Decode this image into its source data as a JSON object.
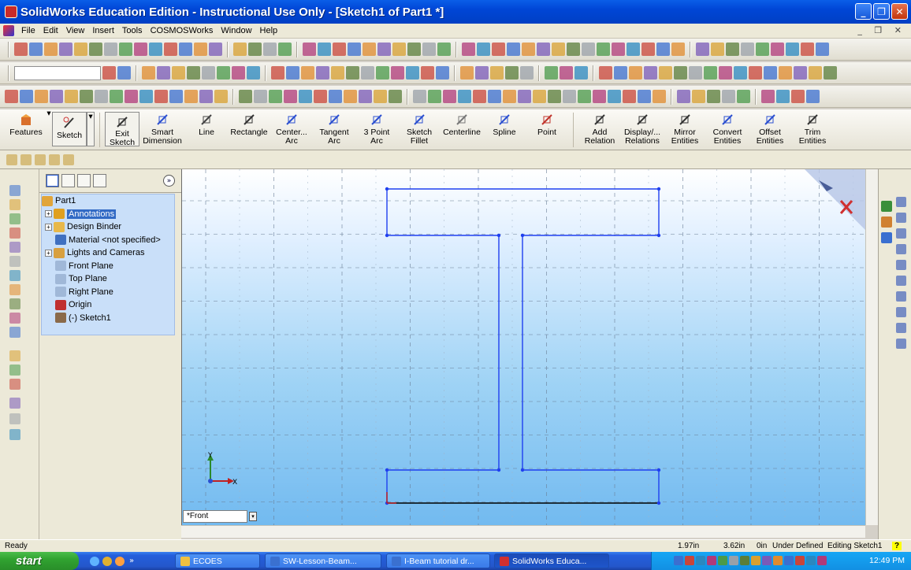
{
  "window": {
    "title": "SolidWorks Education Edition - Instructional Use Only - [Sketch1 of Part1 *]",
    "buttons": [
      "minimize",
      "restore",
      "close"
    ]
  },
  "menu": [
    "File",
    "Edit",
    "View",
    "Insert",
    "Tools",
    "COSMOSWorks",
    "Window",
    "Help"
  ],
  "command_manager": {
    "groups": [
      {
        "label": "Features",
        "dropdown": true,
        "icon": "features-icon"
      },
      {
        "label": "Sketch",
        "dropdown": true,
        "icon": "sketch-icon"
      }
    ],
    "commands": [
      {
        "label": "Exit\nSketch",
        "icon": "exit-sketch-icon"
      },
      {
        "label": "Smart\nDimension",
        "icon": "smart-dimension-icon"
      },
      {
        "label": "Line",
        "icon": "line-icon"
      },
      {
        "label": "Rectangle",
        "icon": "rectangle-icon"
      },
      {
        "label": "Center...\nArc",
        "icon": "center-arc-icon"
      },
      {
        "label": "Tangent\nArc",
        "icon": "tangent-arc-icon"
      },
      {
        "label": "3 Point\nArc",
        "icon": "three-point-arc-icon"
      },
      {
        "label": "Sketch\nFillet",
        "icon": "sketch-fillet-icon"
      },
      {
        "label": "Centerline",
        "icon": "centerline-icon"
      },
      {
        "label": "Spline",
        "icon": "spline-icon"
      },
      {
        "label": "Point",
        "icon": "point-icon"
      },
      {
        "label": "Add\nRelation",
        "icon": "add-relation-icon"
      },
      {
        "label": "Display/...\nRelations",
        "icon": "display-relations-icon"
      },
      {
        "label": "Mirror\nEntities",
        "icon": "mirror-entities-icon"
      },
      {
        "label": "Convert\nEntities",
        "icon": "convert-entities-icon"
      },
      {
        "label": "Offset\nEntities",
        "icon": "offset-entities-icon"
      },
      {
        "label": "Trim\nEntities",
        "icon": "trim-entities-icon"
      }
    ]
  },
  "feature_tree": {
    "root": "Part1",
    "items": [
      {
        "label": "Annotations",
        "expander": "+",
        "selected": true,
        "icon": "annotations-icon"
      },
      {
        "label": "Design Binder",
        "expander": "+",
        "icon": "design-binder-icon"
      },
      {
        "label": "Material <not specified>",
        "expander": "",
        "icon": "material-icon"
      },
      {
        "label": "Lights and Cameras",
        "expander": "+",
        "icon": "lights-cameras-icon"
      },
      {
        "label": "Front Plane",
        "expander": "",
        "icon": "plane-icon"
      },
      {
        "label": "Top Plane",
        "expander": "",
        "icon": "plane-icon"
      },
      {
        "label": "Right Plane",
        "expander": "",
        "icon": "plane-icon"
      },
      {
        "label": "Origin",
        "expander": "",
        "icon": "origin-icon"
      },
      {
        "label": "(-) Sketch1",
        "expander": "",
        "icon": "sketch-icon"
      }
    ],
    "expand_glyph": "»"
  },
  "viewport": {
    "view_name": "*Front",
    "triad": {
      "x": "X",
      "y": "Y"
    },
    "accent": "#1e3ff0"
  },
  "status": {
    "left": "Ready",
    "x": "1.97in",
    "y": "3.62in",
    "z": "0in",
    "state": "Under Defined",
    "mode": "Editing Sketch1",
    "help": "?"
  },
  "taskbar": {
    "start": "start",
    "items": [
      "ECOES",
      "SW-Lesson-Beam...",
      "I-Beam tutorial dr...",
      "SolidWorks Educa..."
    ],
    "active": 3,
    "clock": "12:49 PM",
    "more": "»"
  }
}
